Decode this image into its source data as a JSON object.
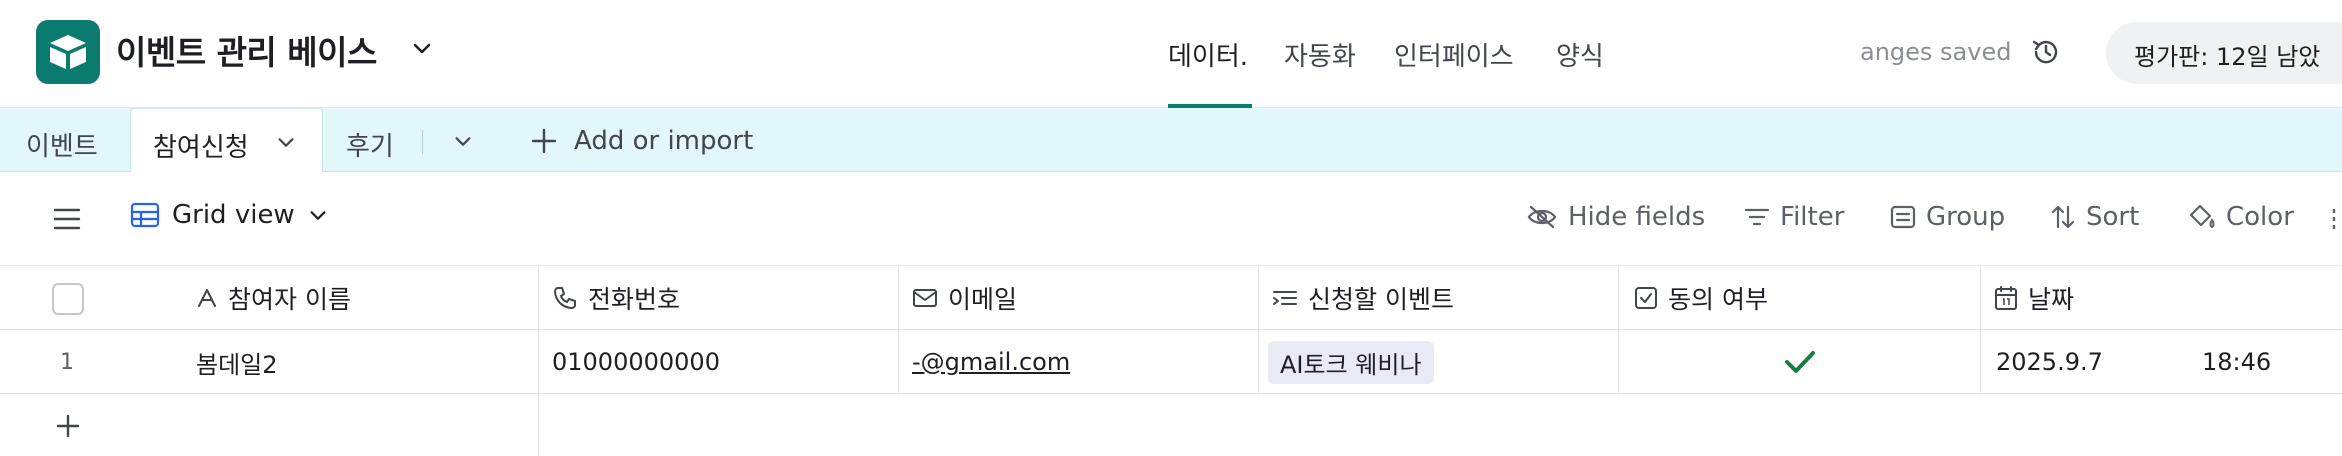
{
  "header": {
    "base_name": "이벤트 관리 베이스",
    "nav": [
      "데이터.",
      "자동화",
      "인터페이스",
      "양식"
    ],
    "saved_status": "anges saved",
    "trial_text": "평가판: 12일 남았"
  },
  "tables": {
    "tab1": "이벤트",
    "tab2": "참여신청",
    "tab3": "후기",
    "add_label": "Add or import"
  },
  "toolbar": {
    "view_name": "Grid view",
    "hide_fields": "Hide fields",
    "filter": "Filter",
    "group": "Group",
    "sort": "Sort",
    "color": "Color"
  },
  "grid": {
    "columns": [
      "참여자 이름",
      "전화번호",
      "이메일",
      "신청할 이벤트",
      "동의 여부",
      "날짜"
    ],
    "rows": [
      {
        "num": "1",
        "name": "봄데일2",
        "phone": "01000000000",
        "email": "-@gmail.com",
        "event": "AI토크 웨비나",
        "consent": true,
        "date": "2025.9.7",
        "time": "18:46"
      }
    ]
  },
  "colors": {
    "brand": "#0b7a6f",
    "tabs_bg": "#e1f7f8",
    "check": "#15803d"
  }
}
